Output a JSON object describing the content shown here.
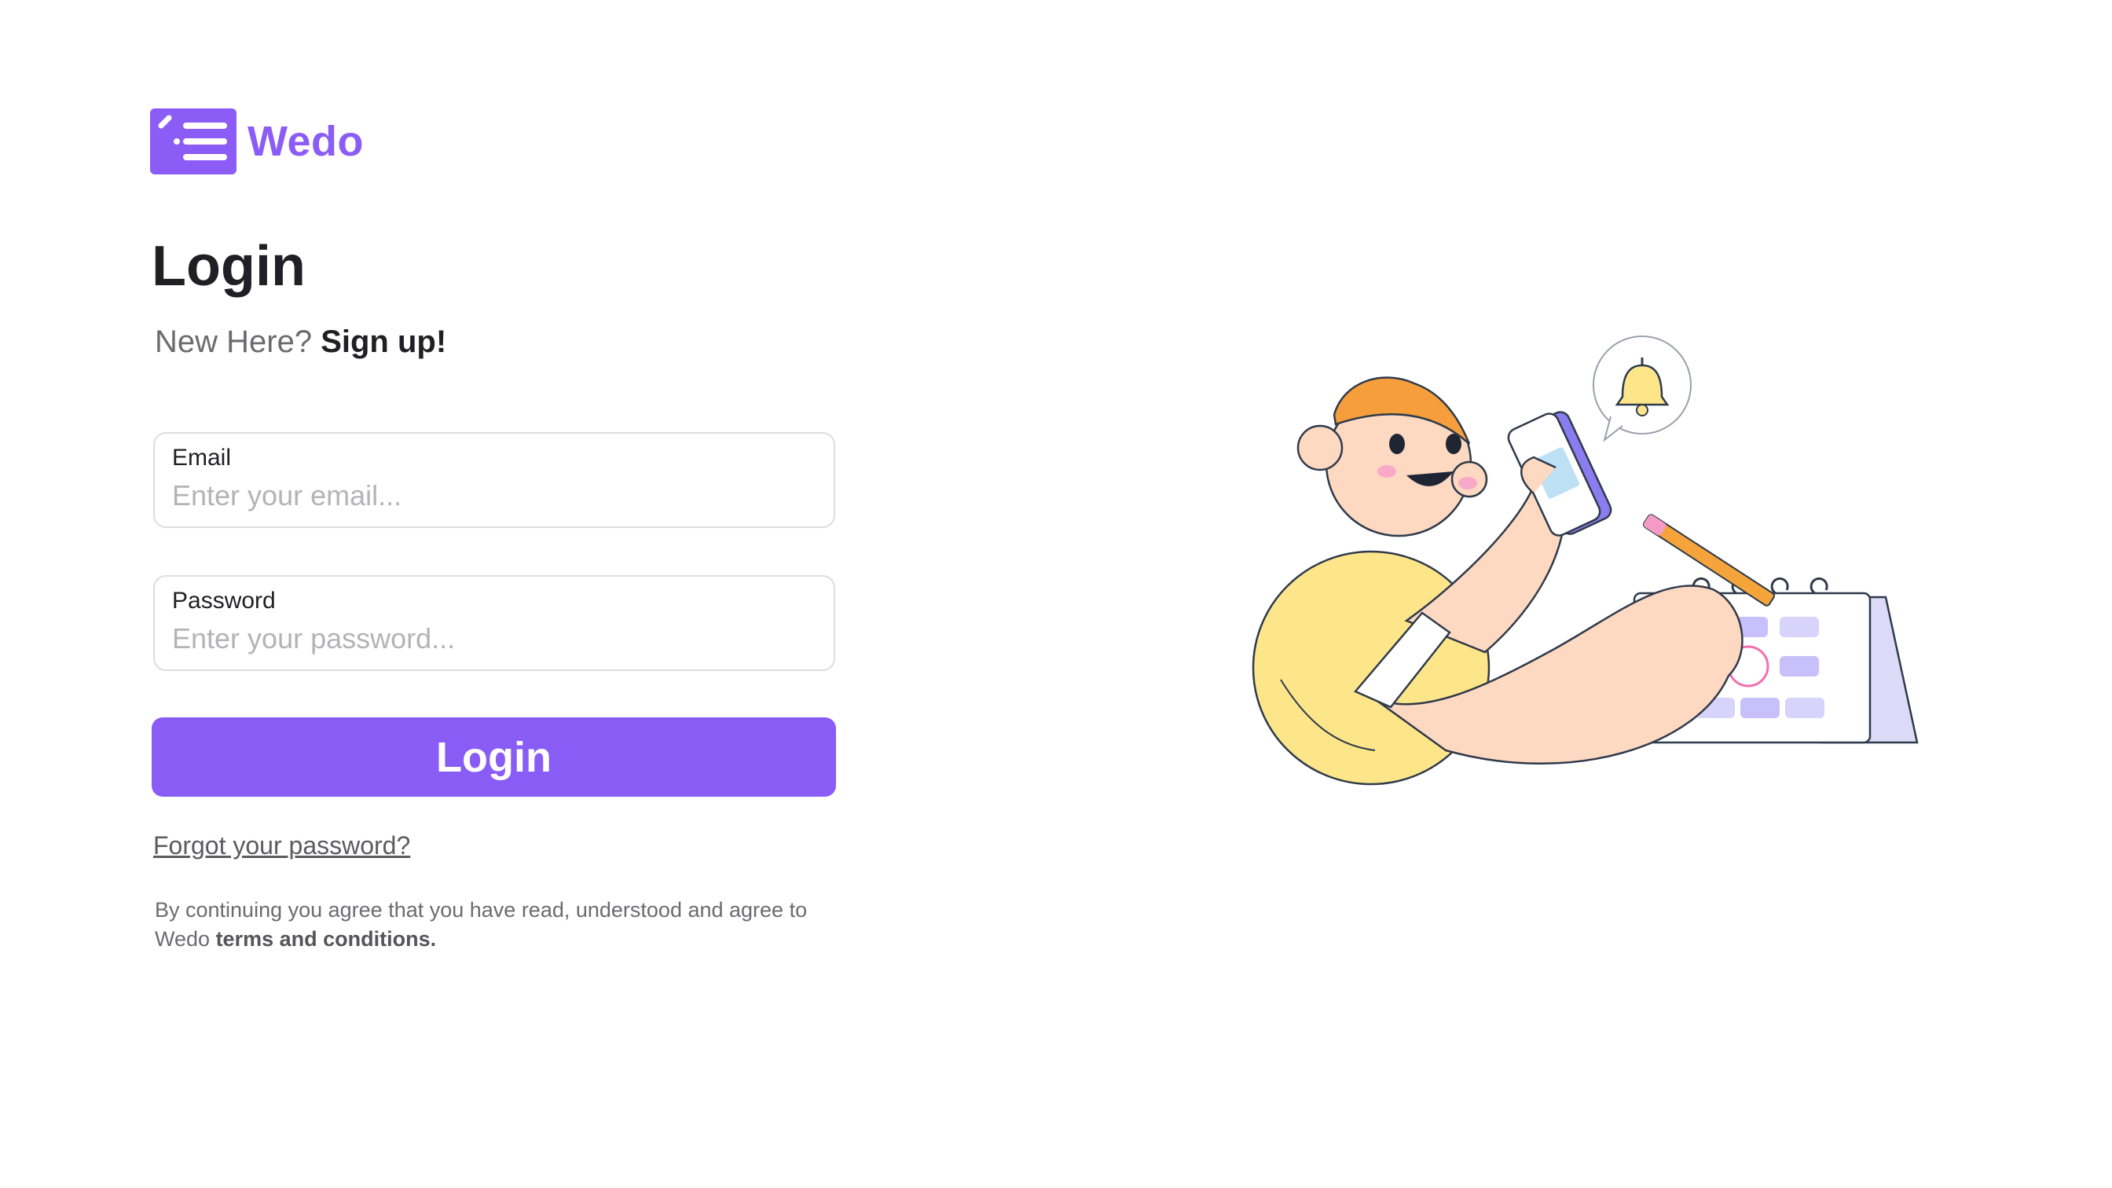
{
  "brand": {
    "name": "Wedo",
    "logo_icon": "checklist-icon",
    "accent_color": "#8b5cf6"
  },
  "login": {
    "title": "Login",
    "signup_prompt": "New Here?",
    "signup_link": "Sign up!",
    "email": {
      "label": "Email",
      "placeholder": "Enter your email...",
      "value": ""
    },
    "password": {
      "label": "Password",
      "placeholder": "Enter your password...",
      "value": ""
    },
    "submit_label": "Login",
    "forgot_link": "Forgot your password?",
    "terms_text": "By continuing you agree that you have read, understood and agree to Wedo",
    "terms_link": "terms and conditions."
  },
  "illustration": {
    "icons": [
      "person-illustration",
      "phone-icon",
      "bell-icon",
      "calendar-icon",
      "pencil-icon"
    ]
  }
}
